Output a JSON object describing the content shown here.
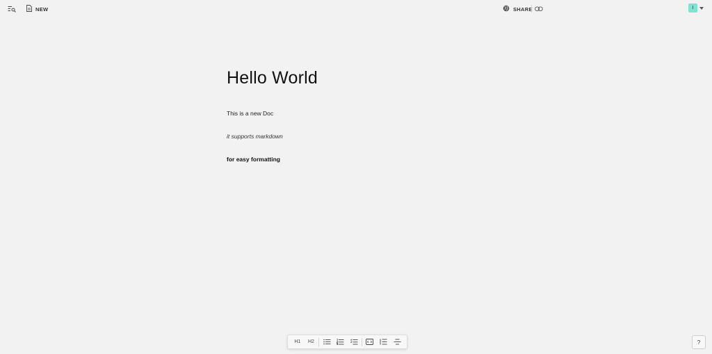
{
  "topbar": {
    "new_label": "NEW",
    "share_label": "SHARE",
    "avatar_initial": "I",
    "icons": [
      "search-list-icon",
      "document-icon",
      "globe-icon",
      "link-icon",
      "chevron-down-icon"
    ]
  },
  "document": {
    "title": "Hello World",
    "paragraphs": [
      "This is a new Doc",
      "it supports markdown",
      "for easy formatting"
    ]
  },
  "toolbar": {
    "h1_label": "H1",
    "h2_label": "H2",
    "icons": [
      "bulleted-list-icon",
      "numbered-list-icon",
      "checklist-icon",
      "code-block-icon",
      "indent-icon",
      "strikethrough-icon"
    ]
  },
  "help_label": "?",
  "colors": {
    "background": "#f2f2f2",
    "avatar": "#80e3d2"
  }
}
